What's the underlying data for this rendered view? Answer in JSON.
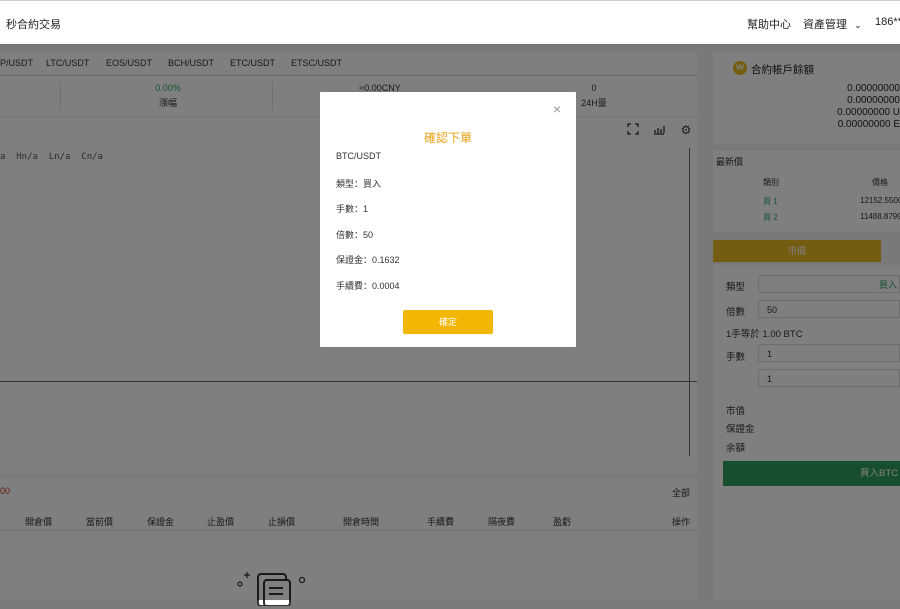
{
  "header": {
    "brand": "秒合約交易",
    "help": "幫助中心",
    "assets": "資產管理",
    "user": "186**"
  },
  "market_tabs": [
    "P/USDT",
    "LTC/USDT",
    "EOS/USDT",
    "BCH/USDT",
    "ETC/USDT",
    "ETSC/USDT"
  ],
  "ticker": {
    "change_value": "0.00%",
    "change_label": "漲幅",
    "cny_value": "≈0.00CNY",
    "volume_value": "0",
    "volume_label": "24H量"
  },
  "chart": {
    "ohlc_text": "a  Hn/a  Ln/a  Cn/a"
  },
  "positions": {
    "count": "00",
    "all_label": "全部",
    "columns": [
      "開倉價",
      "當前價",
      "保證金",
      "止盈價",
      "止損價",
      "開倉時間",
      "手續費",
      "隔夜費",
      "盈虧",
      "操作"
    ]
  },
  "account": {
    "title": "合約帳戶餘額",
    "coin_icon": "coin-icon",
    "balances": [
      "0.00000000",
      "0.00000000",
      "0.00000000 U",
      "0.00000000 E"
    ]
  },
  "latest_price": {
    "title": "最新價",
    "col_type": "類別",
    "col_price": "價格",
    "rows": [
      {
        "type": "買 1",
        "price": "12152.5500"
      },
      {
        "type": "買 2",
        "price": "11488.8799"
      }
    ]
  },
  "order_form": {
    "tab_market": "市價",
    "type_label": "類型",
    "type_value": "買入",
    "leverage_label": "倍數",
    "leverage_value": "50",
    "lot_info": "1手等於 1.00 BTC",
    "lots_label": "手數",
    "lots_value": "1",
    "second_value": "1",
    "market_value_label": "市值",
    "margin_label": "保證金",
    "balance_label": "余額",
    "buy_button": "買入BTC"
  },
  "modal": {
    "title": "確認下單",
    "symbol": "BTC/USDT",
    "type": "類型：買入",
    "lots": "手數：1",
    "leverage": "倍數：50",
    "margin": "保證金：0.1632",
    "fee": "手續費：0.0004",
    "confirm": "確定",
    "close_icon": "close-icon"
  },
  "colors": {
    "accent": "#f2b705",
    "up": "#27ae60",
    "buy": "#2f9e5c"
  }
}
